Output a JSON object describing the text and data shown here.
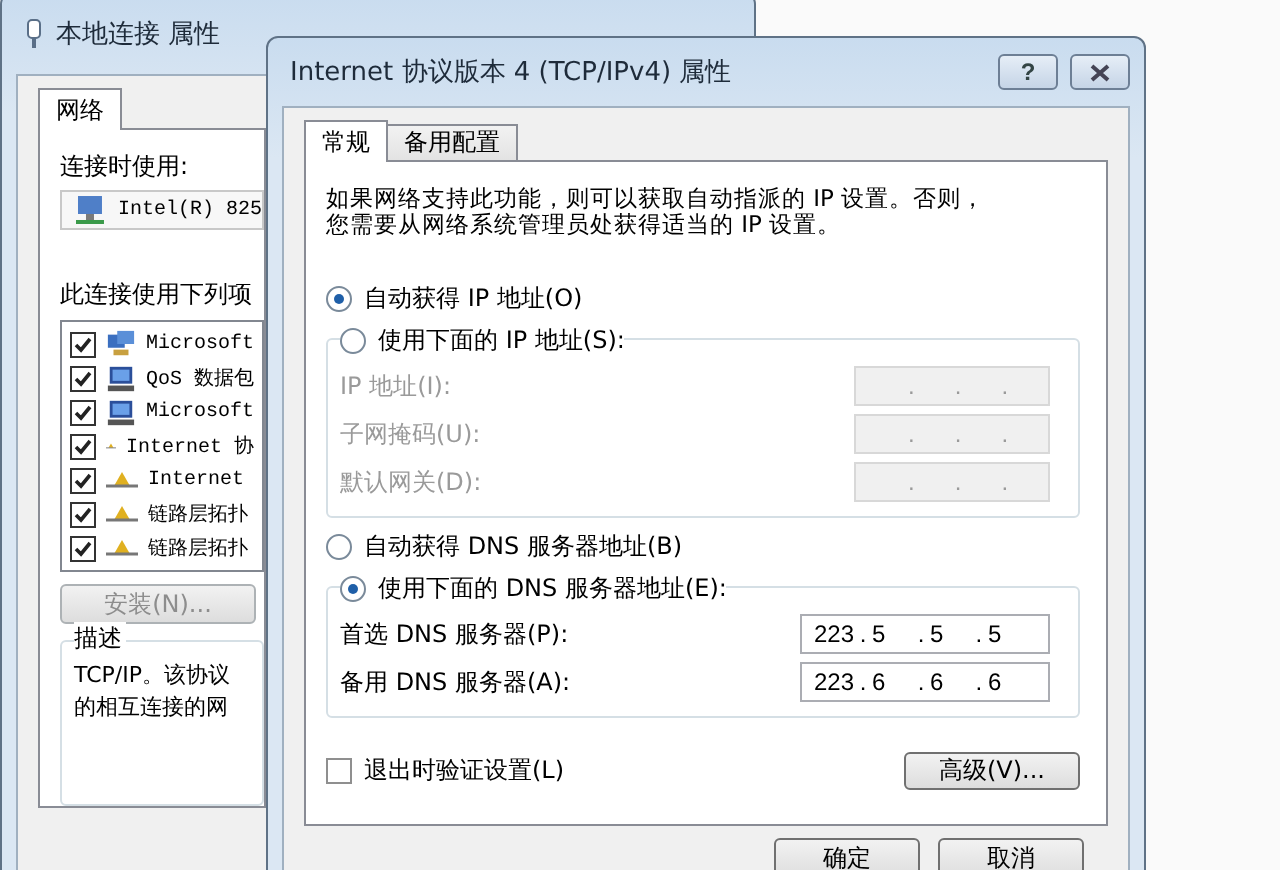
{
  "back_window": {
    "title": "本地连接 属性",
    "tabs": [
      {
        "label": "网络",
        "selected": true
      }
    ],
    "connect_using_label": "连接时使用:",
    "adapter": "Intel(R) 825",
    "items_label": "此连接使用下列项",
    "items": [
      {
        "kind": "client",
        "label": "Microsoft",
        "checked": true
      },
      {
        "kind": "service",
        "label": "QoS 数据包",
        "checked": true
      },
      {
        "kind": "service",
        "label": "Microsoft",
        "checked": true
      },
      {
        "kind": "protocol",
        "label": "Internet 协",
        "checked": true
      },
      {
        "kind": "protocol",
        "label": "Internet",
        "checked": true
      },
      {
        "kind": "protocol",
        "label": "链路层拓扑",
        "checked": true
      },
      {
        "kind": "protocol",
        "label": "链路层拓扑",
        "checked": true
      }
    ],
    "install_button": {
      "label": "安装(N)...",
      "disabled": true
    },
    "description": {
      "title": "描述",
      "lines": [
        "TCP/IP。该协议",
        "的相互连接的网"
      ]
    }
  },
  "dialog": {
    "title": "Internet 协议版本 4 (TCP/IPv4) 属性",
    "help": "?",
    "tabs": [
      {
        "label": "常规",
        "selected": true
      },
      {
        "label": "备用配置",
        "selected": false
      }
    ],
    "intro": [
      "如果网络支持此功能，则可以获取自动指派的 IP 设置。否则，",
      "您需要从网络系统管理员处获得适当的 IP 设置。"
    ],
    "ip_separator": ".",
    "ip_mode": [
      {
        "label": "自动获得 IP 地址(O)",
        "selected": true
      },
      {
        "label": "使用下面的 IP 地址(S):",
        "selected": false
      }
    ],
    "ip_fields": [
      {
        "label": "IP 地址(I):",
        "disabled": true
      },
      {
        "label": "子网掩码(U):",
        "disabled": true
      },
      {
        "label": "默认网关(D):",
        "disabled": true
      }
    ],
    "dns_mode": [
      {
        "label": "自动获得 DNS 服务器地址(B)",
        "selected": false
      },
      {
        "label": "使用下面的 DNS 服务器地址(E):",
        "selected": true
      }
    ],
    "dns_fields": [
      {
        "label": "首选 DNS 服务器(P):",
        "disabled": false,
        "octets": [
          "223",
          "5",
          "5",
          "5"
        ]
      },
      {
        "label": "备用 DNS 服务器(A):",
        "disabled": false,
        "octets": [
          "223",
          "6",
          "6",
          "6"
        ]
      }
    ],
    "validate": {
      "label": "退出时验证设置(L)",
      "checked": false
    },
    "advanced_button": "高级(V)...",
    "buttons": [
      "确定",
      "取消"
    ]
  }
}
